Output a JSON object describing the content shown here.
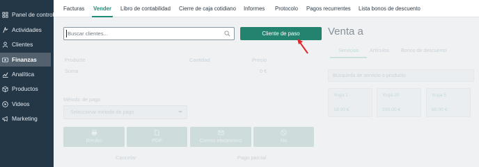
{
  "sidebar": {
    "items": [
      {
        "label": "Panel de control",
        "icon": "dashboard-icon"
      },
      {
        "label": "Actividades",
        "icon": "activity-icon"
      },
      {
        "label": "Clientes",
        "icon": "user-icon"
      },
      {
        "label": "Finanzas",
        "icon": "money-icon"
      },
      {
        "label": "Analítica",
        "icon": "chart-icon"
      },
      {
        "label": "Productos",
        "icon": "box-icon"
      },
      {
        "label": "Videos",
        "icon": "play-icon"
      },
      {
        "label": "Marketing",
        "icon": "megaphone-icon"
      }
    ],
    "active_index": 3
  },
  "tabs": [
    "Facturas",
    "Vender",
    "Libro de contabilidad",
    "Cierre de caja cotidiano",
    "Informes",
    "Protocolo",
    "Pagos recurrentes",
    "Lista bonos de descuento"
  ],
  "active_tab_index": 1,
  "sale": {
    "search_placeholder": "Buscar clientes...",
    "walkin_button": "Cliente de paso",
    "col_product": "Producto",
    "col_quantity": "Cantidad",
    "col_price": "Precio",
    "sum_label": "Suma",
    "sum_value": "0 €",
    "payment_method_label": "Método de pago",
    "payment_method_placeholder": "Seleccionar método de pago",
    "pay_buttons": [
      {
        "label": "Recibo",
        "icon": "print-icon"
      },
      {
        "label": "PDF",
        "icon": "document-icon"
      },
      {
        "label": "Correo electrónico",
        "icon": "mail-icon"
      },
      {
        "label": "No",
        "icon": "cancel-icon"
      }
    ],
    "cancel_label": "Cancelar",
    "partial_label": "Pago parcial"
  },
  "panel": {
    "title": "Venta a",
    "tabs": [
      "Servicios",
      "Artículos",
      "Bonos de descuento"
    ],
    "active_tab_index": 0,
    "search_placeholder": "Búsqueda de servicio o producto",
    "services": [
      {
        "name": "Yoga 1",
        "price": "18,00 €"
      },
      {
        "name": "Yoga 20",
        "price": "250,00 €"
      },
      {
        "name": "Yoga 5",
        "price": "80,00 €"
      }
    ]
  },
  "colors": {
    "sidebar_bg": "#243747",
    "accent": "#23836f",
    "annotation_arrow": "#e3262b"
  }
}
